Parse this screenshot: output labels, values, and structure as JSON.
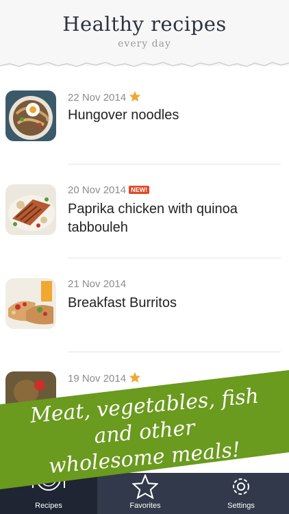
{
  "header": {
    "title": "Healthy recipes",
    "subtitle": "every day"
  },
  "recipes": [
    {
      "date": "22 Nov 2014",
      "name": "Hungover noodles",
      "marker": "star"
    },
    {
      "date": "20 Nov 2014",
      "name": "Paprika chicken with quinoa tabbouleh",
      "marker": "new",
      "badge": "NEW!"
    },
    {
      "date": "21 Nov 2014",
      "name": "Breakfast Burritos",
      "marker": "none"
    },
    {
      "date": "19 Nov 2014",
      "name": "",
      "marker": "star"
    }
  ],
  "banner": {
    "line1": "Meat, vegetables, fish",
    "line2": "and other",
    "line3": "wholesome meals!",
    "color": "#6a9a1e"
  },
  "tabs": [
    {
      "label": "Recipes",
      "icon": "plate-cutlery-icon",
      "active": true
    },
    {
      "label": "Favorites",
      "icon": "star-icon",
      "active": false
    },
    {
      "label": "Settings",
      "icon": "gear-icon",
      "active": false
    }
  ],
  "colors": {
    "tabbar": "#31394a",
    "tab_active": "#1f2533",
    "star": "#f0a833",
    "badge": "#e04a26"
  }
}
